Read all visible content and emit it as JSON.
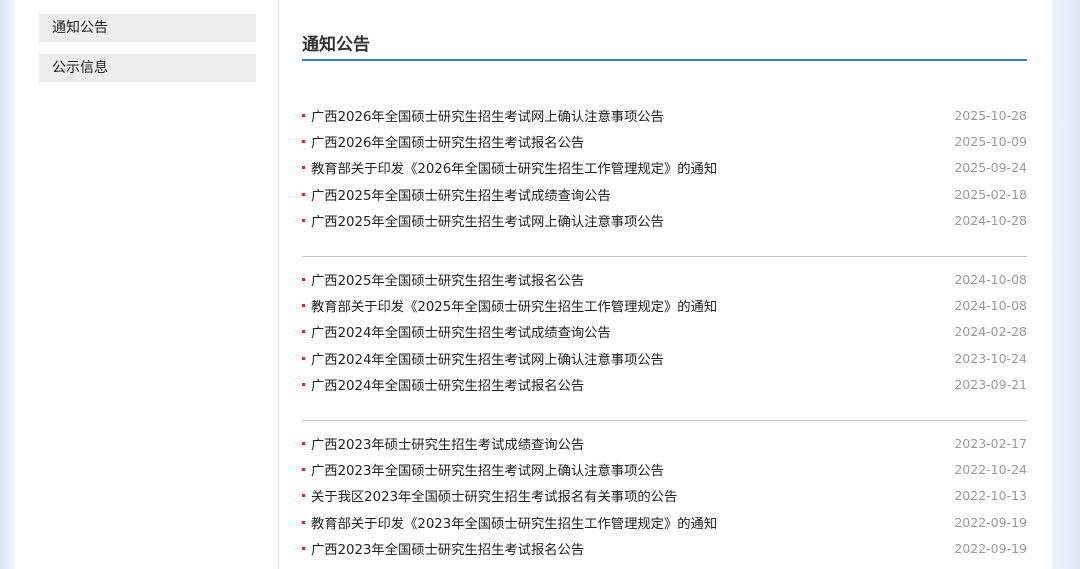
{
  "sidebar": {
    "items": [
      {
        "label": "通知公告"
      },
      {
        "label": "公示信息"
      }
    ]
  },
  "main": {
    "title": "通知公告",
    "groups": [
      [
        {
          "title": "广西2026年全国硕士研究生招生考试网上确认注意事项公告",
          "date": "2025-10-28"
        },
        {
          "title": "广西2026年全国硕士研究生招生考试报名公告",
          "date": "2025-10-09"
        },
        {
          "title": "教育部关于印发《2026年全国硕士研究生招生工作管理规定》的通知",
          "date": "2025-09-24"
        },
        {
          "title": "广西2025年全国硕士研究生招生考试成绩查询公告",
          "date": "2025-02-18"
        },
        {
          "title": "广西2025年全国硕士研究生招生考试网上确认注意事项公告",
          "date": "2024-10-28"
        }
      ],
      [
        {
          "title": "广西2025年全国硕士研究生招生考试报名公告",
          "date": "2024-10-08"
        },
        {
          "title": "教育部关于印发《2025年全国硕士研究生招生工作管理规定》的通知",
          "date": "2024-10-08"
        },
        {
          "title": "广西2024年全国硕士研究生招生考试成绩查询公告",
          "date": "2024-02-28"
        },
        {
          "title": "广西2024年全国硕士研究生招生考试网上确认注意事项公告",
          "date": "2023-10-24"
        },
        {
          "title": "广西2024年全国硕士研究生招生考试报名公告",
          "date": "2023-09-21"
        }
      ],
      [
        {
          "title": "广西2023年硕士研究生招生考试成绩查询公告",
          "date": "2023-02-17"
        },
        {
          "title": "广西2023年全国硕士研究生招生考试网上确认注意事项公告",
          "date": "2022-10-24"
        },
        {
          "title": "关于我区2023年全国硕士研究生招生考试报名有关事项的公告",
          "date": "2022-10-13"
        },
        {
          "title": "教育部关于印发《2023年全国硕士研究生招生工作管理规定》的通知",
          "date": "2022-09-19"
        },
        {
          "title": "广西2023年全国硕士研究生招生考试报名公告",
          "date": "2022-09-19"
        }
      ]
    ]
  },
  "colors": {
    "accent_rule": "#2f7fd6",
    "bullet": "#e0252b",
    "date_text": "#9a9a9a",
    "sidebar_item_bg": "#ededed"
  }
}
